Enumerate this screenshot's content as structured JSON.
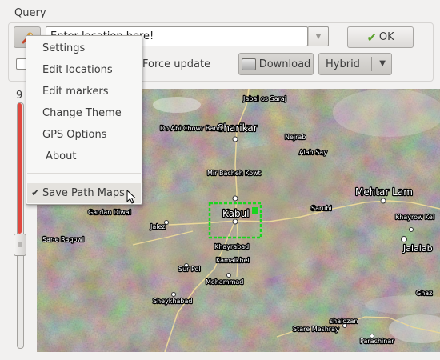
{
  "query": {
    "label": "Query",
    "location_placeholder": "Enter location here!",
    "ok_label": "OK",
    "force_update_label": "Force update",
    "download_label": "Download",
    "map_type": "Hybrid"
  },
  "zoom": {
    "digit": "9",
    "level_fraction": 0.47
  },
  "menu": {
    "items": [
      "Settings",
      "Edit locations",
      "Edit markers",
      "Change Theme",
      "GPS Options",
      "About"
    ],
    "save_path_maps": "Save Path Maps",
    "save_path_maps_checked": true
  },
  "map": {
    "places": [
      "Jabal os Saraj",
      "Charikar",
      "Do Abi Chowr Band",
      "Nejrab",
      "Alah Say",
      "Mir Bacheh Kowt",
      "Kabul",
      "Mehtar Lam",
      "Sarubi",
      "Khayrow Kel",
      "Jalalab",
      "Gardan Diwal",
      "Jalez",
      "Sar-e Raqowl",
      "Khayrabad",
      "Kamalkhel",
      "Sur Pol",
      "Mohammad",
      "Sheykhabad",
      "shalozan",
      "Stare Meshray",
      "Parachinar",
      "Ghaz"
    ],
    "selection_color": "#19d41f"
  }
}
